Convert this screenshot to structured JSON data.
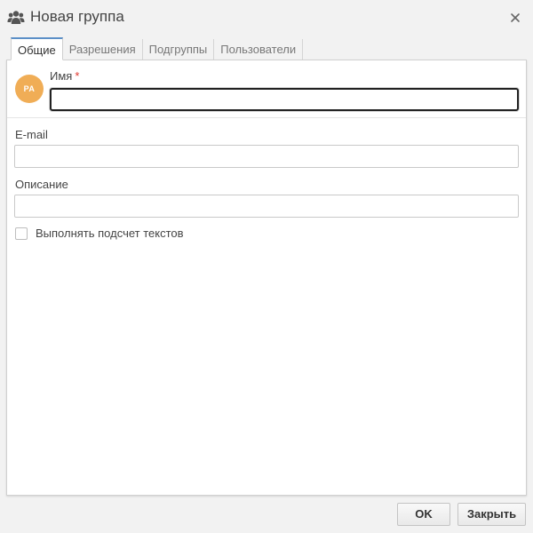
{
  "dialog": {
    "title": "Новая группа",
    "title_icon": "users-group-icon",
    "close_icon": "close-icon"
  },
  "tabs": [
    {
      "label": "Общие",
      "active": true
    },
    {
      "label": "Разрешения",
      "active": false
    },
    {
      "label": "Подгруппы",
      "active": false
    },
    {
      "label": "Пользователи",
      "active": false
    }
  ],
  "form": {
    "avatar_initials": "PA",
    "avatar_color": "#f0ad56",
    "name_label": "Имя",
    "required_marker": "*",
    "name_value": "",
    "email_label": "E-mail",
    "email_value": "",
    "description_label": "Описание",
    "description_value": "",
    "count_texts_label": "Выполнять подсчет текстов",
    "count_texts_checked": false
  },
  "footer": {
    "ok_label": "OK",
    "close_label": "Закрыть"
  },
  "colors": {
    "accent_tab": "#5b8fc7",
    "required": "#e0382f"
  }
}
